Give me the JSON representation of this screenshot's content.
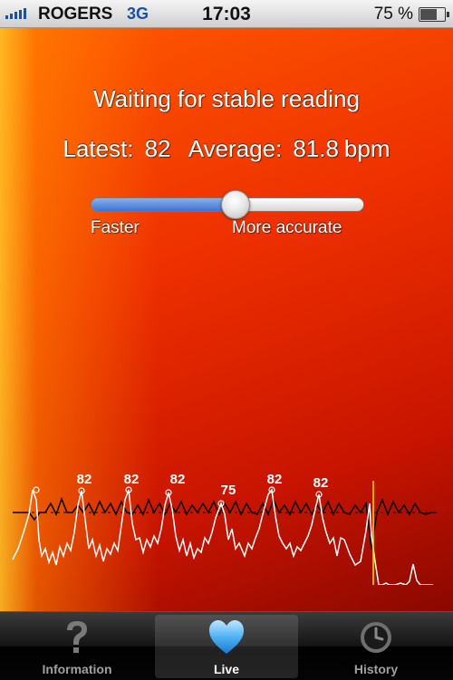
{
  "status_bar": {
    "carrier": "ROGERS",
    "network": "3G",
    "time": "17:03",
    "battery_text": "75 %",
    "battery_level": 0.75
  },
  "measurement": {
    "status": "Waiting for stable reading",
    "latest_label": "Latest:",
    "latest_value": "82",
    "average_label": "Average:",
    "average_value": "81.8",
    "unit": "bpm"
  },
  "slider": {
    "left_label": "Faster",
    "right_label": "More accurate",
    "value": 0.53
  },
  "waveform": {
    "peak_labels": [
      "82",
      "82",
      "82",
      "75",
      "82",
      "82"
    ],
    "colors": {
      "pulse_trace": "#ffffff",
      "rate_trace": "#000000",
      "cursor": "#ffe000"
    }
  },
  "tabbar": {
    "tabs": [
      {
        "label": "Information",
        "icon": "question-mark-icon",
        "active": false
      },
      {
        "label": "Live",
        "icon": "heart-icon",
        "active": true
      },
      {
        "label": "History",
        "icon": "clock-icon",
        "active": false
      }
    ]
  }
}
